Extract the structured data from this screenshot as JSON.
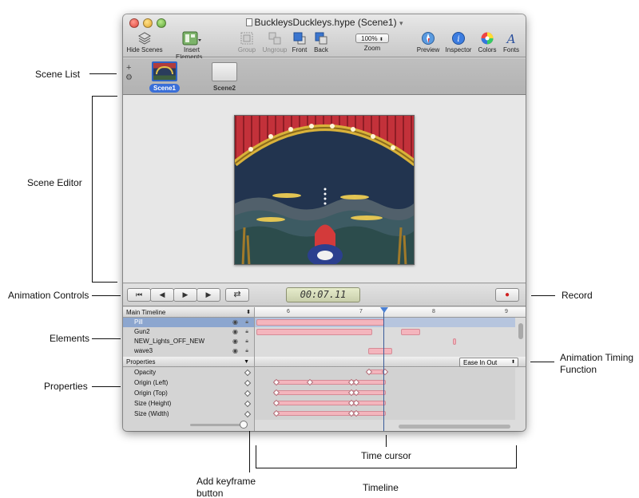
{
  "window": {
    "title": "BuckleysDuckleys.hype (Scene1)",
    "title_suffix": "▾"
  },
  "toolbar": {
    "hide_scenes": "Hide Scenes",
    "insert_elements": "Insert Elements...",
    "group": "Group",
    "ungroup": "Ungroup",
    "front": "Front",
    "back": "Back",
    "zoom_value": "100%",
    "zoom_label": "Zoom",
    "preview": "Preview",
    "inspector": "Inspector",
    "colors": "Colors",
    "fonts": "Fonts"
  },
  "scene_list": {
    "add_symbol": "+",
    "gear_symbol": "⚙",
    "scenes": [
      {
        "label": "Scene1",
        "selected": true
      },
      {
        "label": "Scene2",
        "selected": false
      }
    ]
  },
  "animation_controls": {
    "time": "00:07.11",
    "first_symbol": "⏮",
    "prev_symbol": "◀",
    "next_symbol": "▶",
    "play_symbol": "▶",
    "loop_symbol": "⇄",
    "record_symbol": "●"
  },
  "timeline": {
    "timeline_name": "Main Timeline",
    "ruler_labels": [
      "6",
      "7",
      "8",
      "9"
    ],
    "elements": [
      {
        "name": "Pill",
        "selected": true
      },
      {
        "name": "Gun2",
        "selected": false
      },
      {
        "name": "NEW_Lights_OFF_NEW",
        "selected": false
      },
      {
        "name": "wave3",
        "selected": false
      }
    ],
    "properties_header": "Properties",
    "timing_function": "Ease In Out",
    "properties": [
      "Opacity",
      "Origin (Left)",
      "Origin (Top)",
      "Size (Height)",
      "Size (Width)"
    ]
  },
  "annotations": {
    "scene_list": "Scene List",
    "scene_editor": "Scene Editor",
    "animation_controls": "Animation Controls",
    "record": "Record",
    "elements": "Elements",
    "animation_timing_line1": "Animation Timing",
    "animation_timing_line2": "Function",
    "properties": "Properties",
    "time_cursor": "Time cursor",
    "add_keyframe_line1": "Add keyframe",
    "add_keyframe_line2": "button",
    "timeline": "Timeline"
  },
  "colors": {
    "accent_selection": "#3a6fd8",
    "keyframe_bar": "#f4b5bd",
    "record_red": "#d02020"
  }
}
